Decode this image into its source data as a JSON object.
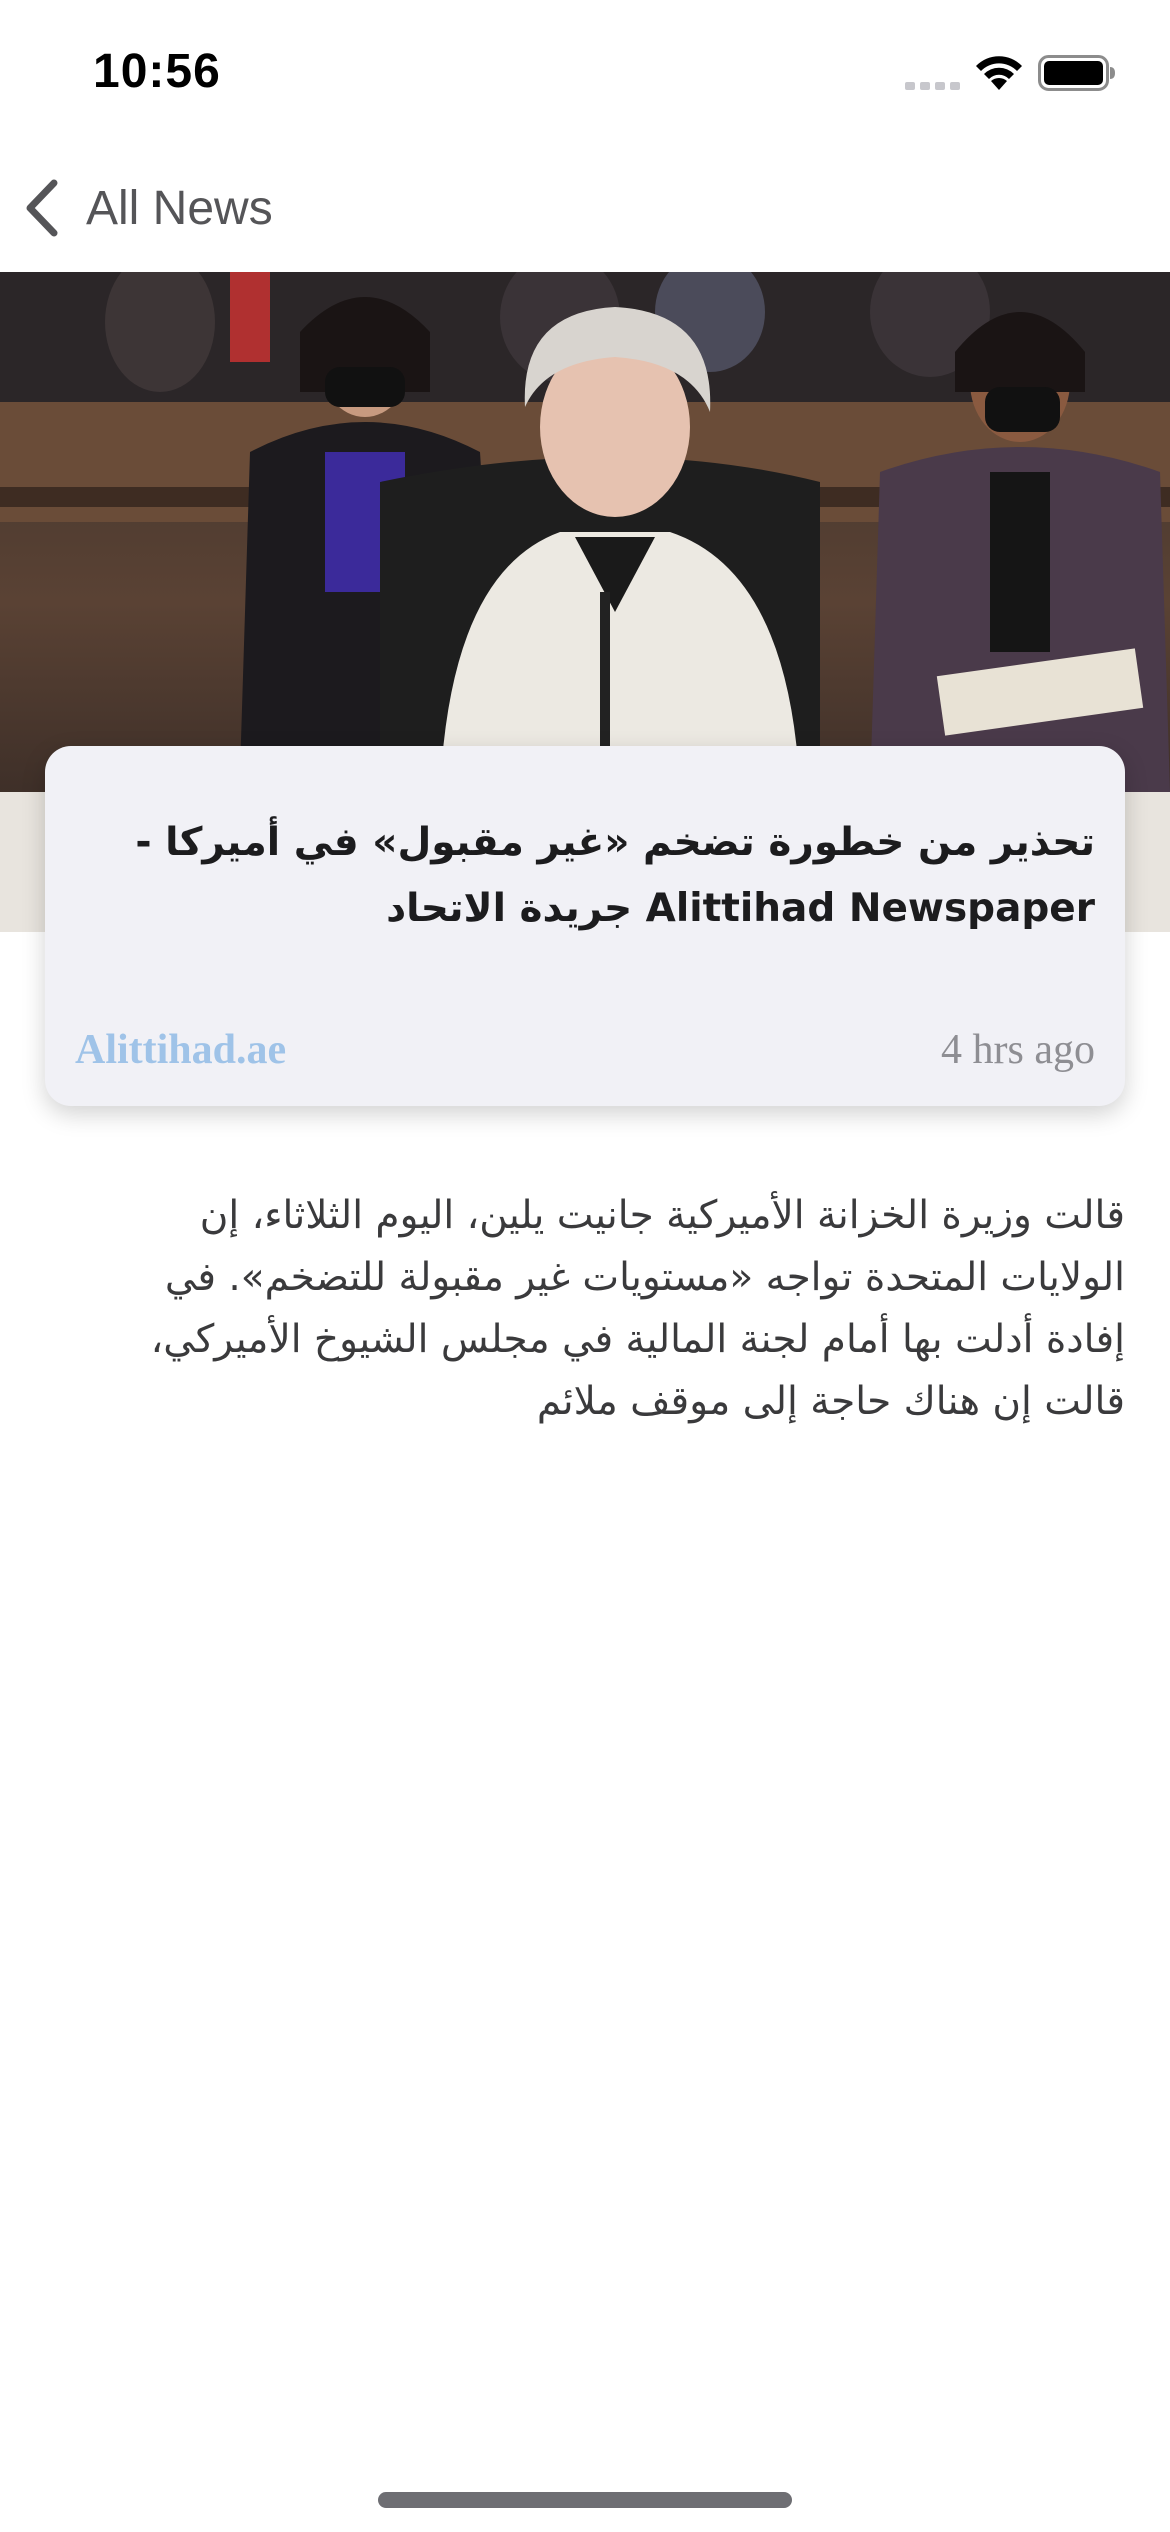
{
  "status_bar": {
    "time": "10:56",
    "icons": [
      "signal-icon",
      "wifi-icon",
      "battery-icon"
    ]
  },
  "nav": {
    "back_label": "All News",
    "back_icon": "chevron-left-icon"
  },
  "hero_image": {
    "alt_semantic": "hearing-photo"
  },
  "article": {
    "title": "تحذير من خطورة تضخم «غير مقبول» في أميركا - Alittihad Newspaper جريدة الاتحاد",
    "source": "Alittihad.ae",
    "time_ago": "4 hrs ago",
    "body": "قالت وزيرة الخزانة الأميركية جانيت يلين، اليوم الثلاثاء، إن الولايات المتحدة تواجه «مستويات غير مقبولة للتضخم». في إفادة أدلت بها أمام لجنة المالية في مجلس الشيوخ الأميركي، قالت إن هناك حاجة إلى موقف ملائم"
  },
  "colors": {
    "card_bg": "#f1f1f6",
    "source_link": "#9fc3e8",
    "secondary_text": "#8e8e93",
    "nav_text": "#555558"
  }
}
